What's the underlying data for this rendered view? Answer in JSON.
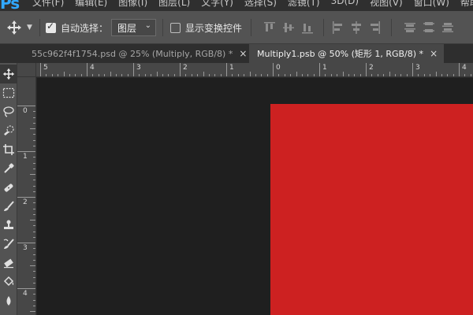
{
  "menubar": {
    "logo": "Ps",
    "items": [
      "文件(F)",
      "编辑(E)",
      "图像(I)",
      "图层(L)",
      "文字(Y)",
      "选择(S)",
      "滤镜(T)",
      "3D(D)",
      "视图(V)",
      "窗口(W)",
      "帮助"
    ]
  },
  "options": {
    "auto_select_label": "自动选择：",
    "auto_select_checked": true,
    "layer_select_value": "图层",
    "show_transform_label": "显示变换控件",
    "show_transform_checked": false
  },
  "tabs": [
    {
      "title": "55c962f4f1754.psd @ 25% (Multiply, RGB/8) *",
      "active": false
    },
    {
      "title": "Multiply1.psb @ 50% (矩形 1, RGB/8) *",
      "active": true
    }
  ],
  "tab_close": "×",
  "rulers": {
    "horizontal_labels": [
      "5",
      "4",
      "3",
      "2",
      "1",
      "0",
      "1",
      "2",
      "3",
      "4"
    ],
    "vertical_labels": [
      "0",
      "1",
      "2",
      "3",
      "4"
    ]
  },
  "canvas": {
    "workspace_color": "#1f1f1f",
    "document_fill": "#cd2121"
  }
}
